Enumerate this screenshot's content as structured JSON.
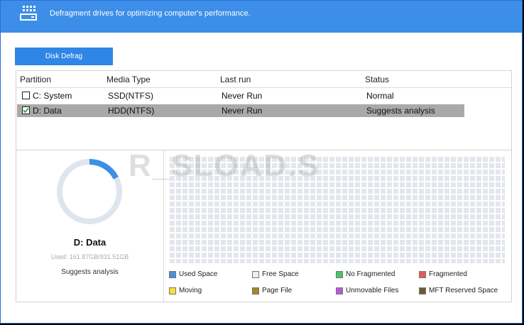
{
  "header": {
    "title": "Defragment drives for optimizing computer's performance."
  },
  "toolbar": {
    "defrag_label": "Disk Defrag"
  },
  "table": {
    "columns": [
      "Partition",
      "Media Type",
      "Last run",
      "Status"
    ],
    "rows": [
      {
        "checked": false,
        "partition": "C:  System",
        "media": "SSD(NTFS)",
        "last_run": "Never Run",
        "status": "Normal"
      },
      {
        "checked": true,
        "partition": "D:  Data",
        "media": "HDD(NTFS)",
        "last_run": "Never Run",
        "status": "Suggests analysis"
      }
    ]
  },
  "details": {
    "drive": "D:  Data",
    "used": "Used: 161.87GB/931.51GB",
    "used_fraction": 0.174,
    "status": "Suggests analysis"
  },
  "legend": [
    {
      "label": "Used Space",
      "color": "#4a90d9"
    },
    {
      "label": "Free Space",
      "color": "#eeeeee"
    },
    {
      "label": "No Fragmented",
      "color": "#4cc36a"
    },
    {
      "label": "Fragmented",
      "color": "#e45a5a"
    },
    {
      "label": "Moving",
      "color": "#f2e13c"
    },
    {
      "label": "Page File",
      "color": "#a68428"
    },
    {
      "label": "Unmovable Files",
      "color": "#b75ad9"
    },
    {
      "label": "MFT Reserved Space",
      "color": "#6b5a2a"
    }
  ],
  "watermark": "R_SLOAD.S"
}
